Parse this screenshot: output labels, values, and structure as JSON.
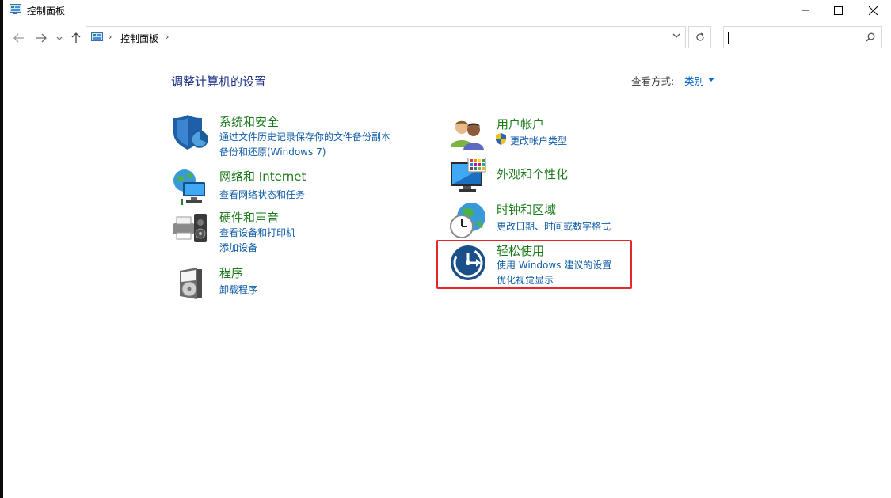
{
  "window": {
    "title": "控制面板"
  },
  "address": {
    "crumb": "控制面板",
    "search_value": ""
  },
  "main": {
    "heading": "调整计算机的设置",
    "view_by_label": "查看方式:",
    "view_by_value": "类别"
  },
  "categories": {
    "system_security": {
      "name": "系统和安全",
      "links": [
        "通过文件历史记录保存你的文件备份副本",
        "备份和还原(Windows 7)"
      ]
    },
    "network": {
      "name": "网络和 Internet",
      "links": [
        "查看网络状态和任务"
      ]
    },
    "hardware": {
      "name": "硬件和声音",
      "links": [
        "查看设备和打印机",
        "添加设备"
      ]
    },
    "programs": {
      "name": "程序",
      "links": [
        "卸载程序"
      ]
    },
    "user_accounts": {
      "name": "用户帐户",
      "links": [
        "更改帐户类型"
      ]
    },
    "appearance": {
      "name": "外观和个性化",
      "links": []
    },
    "clock_region": {
      "name": "时钟和区域",
      "links": [
        "更改日期、时间或数字格式"
      ]
    },
    "ease_of_access": {
      "name": "轻松使用",
      "links": [
        "使用 Windows 建议的设置",
        "优化视觉显示"
      ]
    }
  },
  "colors": {
    "category_title": "#1a7a1a",
    "link": "#0f5ca8",
    "heading": "#1e3287",
    "highlight": "#e5262a"
  }
}
